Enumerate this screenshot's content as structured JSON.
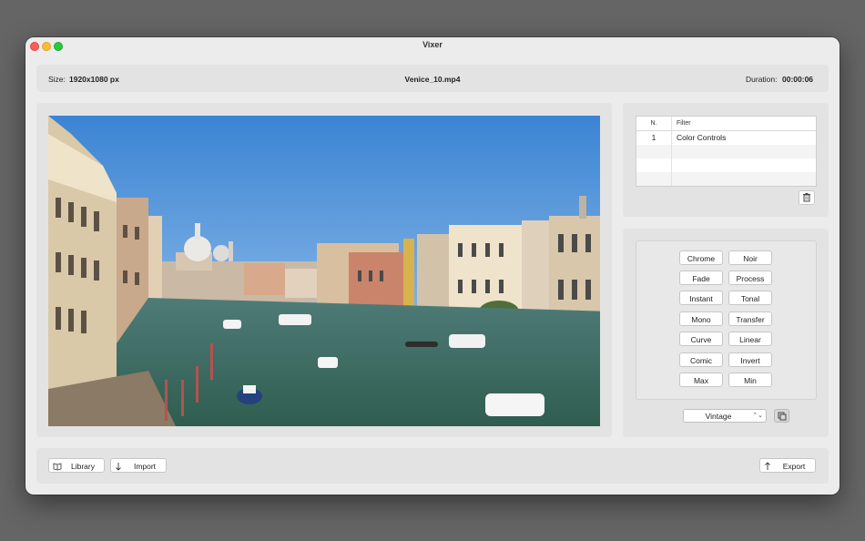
{
  "window": {
    "title": "Vixer"
  },
  "info": {
    "size_label": "Size:",
    "size_value": "1920x1080 px",
    "filename": "Venice_10.mp4",
    "duration_label": "Duration:",
    "duration_value": "00:00:06"
  },
  "filters_table": {
    "columns": [
      "N.",
      "Filter"
    ],
    "rows": [
      {
        "n": "1",
        "filter": "Color Controls"
      }
    ]
  },
  "presets": {
    "buttons": [
      "Chrome",
      "Noir",
      "Fade",
      "Process",
      "Instant",
      "Tonal",
      "Mono",
      "Transfer",
      "Curve",
      "Linear",
      "Comic",
      "Invert",
      "Max",
      "Min"
    ],
    "selected_preset": "Vintage"
  },
  "toolbar": {
    "library_label": "Library",
    "import_label": "Import",
    "export_label": "Export"
  },
  "icons": {
    "library": "book-icon",
    "import": "arrow-down-icon",
    "export": "arrow-up-icon",
    "delete": "trash-icon",
    "apply": "copy-icon"
  },
  "colors": {
    "window_bg": "#ececec",
    "panel_bg": "#e3e3e3",
    "close": "#fd5d57",
    "minimize": "#fdbb2e",
    "maximize": "#29c940"
  }
}
